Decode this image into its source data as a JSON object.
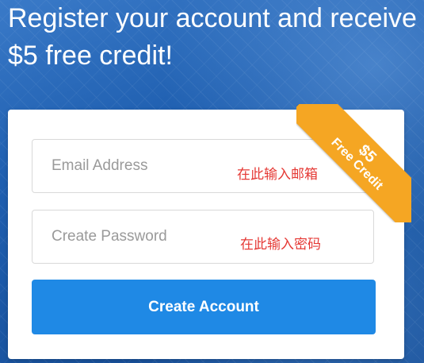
{
  "headline": {
    "line1": "Register your account and receive",
    "line2": "$5 free credit!"
  },
  "form": {
    "email": {
      "placeholder": "Email Address",
      "annotation": "在此输入邮箱"
    },
    "password": {
      "placeholder": "Create Password",
      "annotation": "在此输入密码"
    },
    "submit_label": "Create Account"
  },
  "ribbon": {
    "amount": "$5",
    "text": "Free Credit"
  },
  "colors": {
    "background": "#1d5aa8",
    "button": "#1f89e5",
    "ribbon": "#f5a623",
    "annotation": "#e53935"
  }
}
